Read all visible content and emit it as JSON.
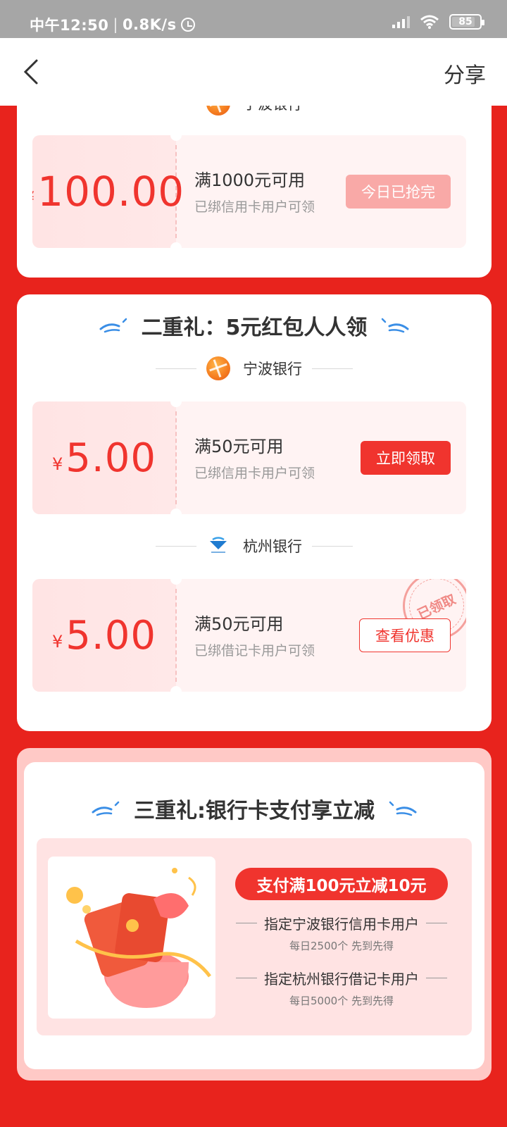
{
  "status_bar": {
    "time": "中午12:50",
    "speed": "0.8K/s",
    "battery": "85"
  },
  "nav": {
    "share_label": "分享"
  },
  "card1": {
    "bank_name": "宁波银行",
    "coupon": {
      "currency": "¥",
      "amount": "100.00",
      "condition": "满1000元可用",
      "eligibility": "已绑信用卡用户可领",
      "button": "今日已抢完"
    }
  },
  "card2": {
    "title": "二重礼：5元红包人人领",
    "banks": [
      {
        "name": "宁波银行",
        "coupon": {
          "currency": "¥",
          "amount": "5.00",
          "condition": "满50元可用",
          "eligibility": "已绑信用卡用户可领",
          "button": "立即领取"
        }
      },
      {
        "name": "杭州银行",
        "coupon": {
          "currency": "¥",
          "amount": "5.00",
          "condition": "满50元可用",
          "eligibility": "已绑借记卡用户可领",
          "button": "查看优惠",
          "stamp": "已领取"
        }
      }
    ]
  },
  "card3": {
    "title": "三重礼:银行卡支付享立减",
    "tag": "支付满100元立减10元",
    "offers": [
      {
        "target": "指定宁波银行信用卡用户",
        "note": "每日2500个 先到先得"
      },
      {
        "target": "指定杭州银行借记卡用户",
        "note": "每日5000个 先到先得"
      }
    ]
  },
  "colors": {
    "brand_red": "#f0342e",
    "background_red": "#e8231d"
  }
}
